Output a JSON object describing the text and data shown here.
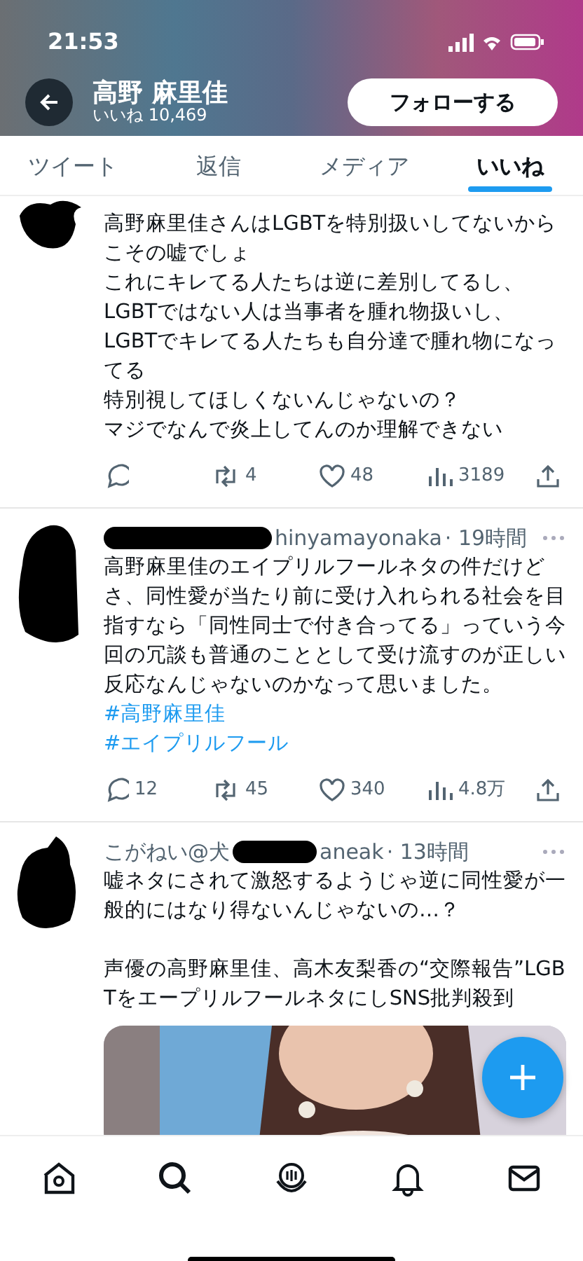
{
  "status_bar": {
    "time": "21:53"
  },
  "profile_header": {
    "name": "高野 麻里佳",
    "likes_count": "いいね 10,469",
    "follow_button": "フォローする"
  },
  "tabs": [
    {
      "label": "ツイート",
      "selected": false
    },
    {
      "label": "返信",
      "selected": false
    },
    {
      "label": "メディア",
      "selected": false
    },
    {
      "label": "いいね",
      "selected": true
    }
  ],
  "tweets": [
    {
      "paragraphs": [
        [
          "高野麻里佳さんはLGBTを特別扱いしてないからこその嘘でしょ",
          "これにキレてる人たちは逆に差別してるし、",
          "LGBTではない人は当事者を腫れ物扱いし、",
          "LGBTでキレてる人たちも自分達で腫れ物になってる",
          "特別視してほしくないんじゃないの？",
          "マジでなんで炎上してんのか理解できない"
        ]
      ],
      "stats": {
        "retweet": "4",
        "like": "48",
        "views": "3189"
      }
    },
    {
      "author_fragments": [
        "hinyamayonaka"
      ],
      "time": "· 19時間",
      "paragraphs": [
        [
          "高野麻里佳のエイプリルフールネタの件だけどさ、同性愛が当たり前に受け入れられる社会を目指すなら「同性同士で付き合ってる」っていう今回の冗談も普通のこととして受け流すのが正しい反応なんじゃないのかなって思いました。"
        ]
      ],
      "hashtags": [
        "#高野麻里佳",
        "#エイプリルフール"
      ],
      "stats": {
        "reply": "12",
        "retweet": "45",
        "like": "340",
        "views": "4.8万"
      }
    },
    {
      "author_fragments": [
        "こがねい@犬",
        "aneak"
      ],
      "time": "· 13時間",
      "paragraphs": [
        [
          "嘘ネタにされて激怒するようじゃ逆に同性愛が一般的にはなり得ないんじゃないの…？"
        ],
        [
          "声優の高野麻里佳、高木友梨香の“交際報告”LGBTをエープリルフールネタにしSNS批判殺到"
        ]
      ],
      "media": {
        "kind": "picture"
      }
    }
  ]
}
